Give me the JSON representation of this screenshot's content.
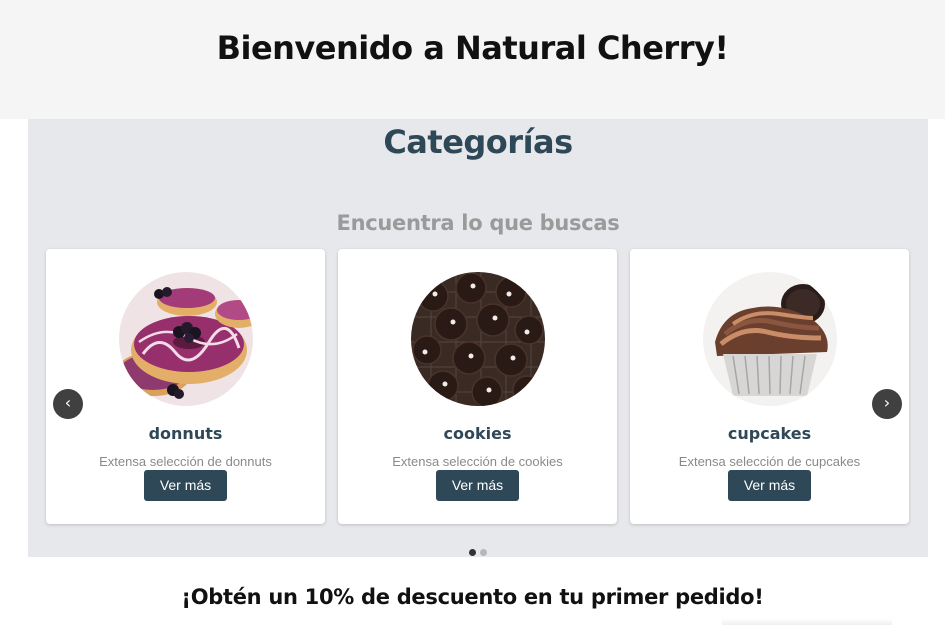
{
  "header": {
    "title": "Bienvenido a Natural Cherry!"
  },
  "categories": {
    "heading": "Categorías",
    "subheading": "Encuentra lo que buscas",
    "cards": [
      {
        "title": "donnuts",
        "description": "Extensa selección de donnuts",
        "button": "Ver más",
        "icon": "donut-photo"
      },
      {
        "title": "cookies",
        "description": "Extensa selección de cookies",
        "button": "Ver más",
        "icon": "cookie-photo"
      },
      {
        "title": "cupcakes",
        "description": "Extensa selección de cupcakes",
        "button": "Ver más",
        "icon": "cupcake-photo"
      }
    ],
    "prev_icon": "‹",
    "next_icon": "›",
    "dots": 2,
    "active_dot": 0
  },
  "promo": {
    "text": "¡Obtén un 10% de descuento en tu primer pedido!"
  },
  "colors": {
    "accent": "#2f4858",
    "section_bg": "#e7e8ec",
    "header_bg": "#f5f5f6"
  }
}
